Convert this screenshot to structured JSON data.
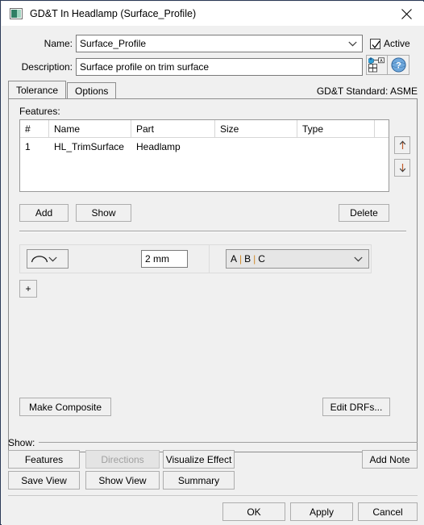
{
  "window": {
    "title": "GD&T In Headlamp (Surface_Profile)",
    "icon": "app-square-icon",
    "close_label": "✕"
  },
  "form": {
    "name_label": "Name:",
    "name_value": "Surface_Profile",
    "active_label": "Active",
    "active_checked": true,
    "description_label": "Description:",
    "description_value": "Surface profile on trim surface",
    "icon_buttons": [
      {
        "name": "feature-control-frame-icon",
        "tooltip": ""
      },
      {
        "name": "help-icon",
        "tooltip": ""
      }
    ]
  },
  "tabs": {
    "items": [
      {
        "label": "Tolerance",
        "active": true
      },
      {
        "label": "Options",
        "active": false
      }
    ],
    "standard_label": "GD&T Standard: ASME"
  },
  "features": {
    "label": "Features:",
    "columns": [
      "#",
      "Name",
      "Part",
      "Size",
      "Type"
    ],
    "rows": [
      {
        "num": "1",
        "name": "HL_TrimSurface",
        "part": "Headlamp",
        "size": "",
        "type": ""
      }
    ],
    "move_up": "↑",
    "move_down": "↓",
    "add_label": "Add",
    "show_label": "Show",
    "delete_label": "Delete"
  },
  "tolerance": {
    "symbol": "surface-profile-symbol",
    "value": "2 mm",
    "datum_a": "A",
    "datum_b": "B",
    "datum_c": "C",
    "datum_sep": "|",
    "add_row_label": "+",
    "make_composite_label": "Make Composite",
    "edit_drfs_label": "Edit DRFs..."
  },
  "show_group": {
    "label": "Show:",
    "buttons": [
      {
        "label": "Features",
        "disabled": false
      },
      {
        "label": "Directions",
        "disabled": true
      },
      {
        "label": "Visualize Effect",
        "disabled": false
      },
      {
        "label": "Add Note",
        "disabled": false
      },
      {
        "label": "Save View",
        "disabled": false
      },
      {
        "label": "Show View",
        "disabled": false
      },
      {
        "label": "Summary",
        "disabled": false
      }
    ]
  },
  "footer": {
    "ok_label": "OK",
    "apply_label": "Apply",
    "cancel_label": "Cancel"
  },
  "colors": {
    "dialog_bg": "#f0f0f0",
    "frame": "#2b3a57",
    "field_bg": "#ffffff",
    "datum_accent": "#d08a2a",
    "icon_blue": "#2f6fd0",
    "title_icon_green": "#2f7f64"
  }
}
